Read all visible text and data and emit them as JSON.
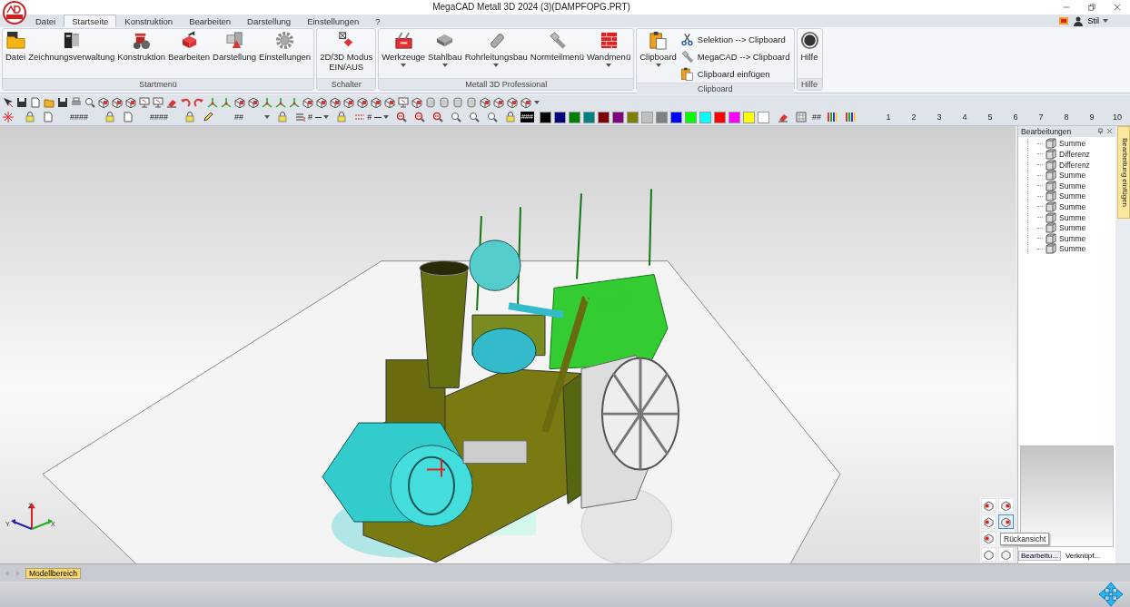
{
  "window": {
    "title": "MegaCAD Metall 3D 2024 (3)(DAMPFOPG.PRT)"
  },
  "tabs": [
    {
      "label": "Datei",
      "selected": false
    },
    {
      "label": "Startseite",
      "selected": true
    },
    {
      "label": "Konstruktion",
      "selected": false
    },
    {
      "label": "Bearbeiten",
      "selected": false
    },
    {
      "label": "Darstellung",
      "selected": false
    },
    {
      "label": "Einstellungen",
      "selected": false
    },
    {
      "label": "?",
      "selected": false
    }
  ],
  "style_menu": {
    "label": "Stil"
  },
  "ribbon_groups": [
    {
      "title": "Startmenü",
      "buttons": [
        {
          "kind": "large",
          "label": "Datei",
          "dropdown": false
        },
        {
          "kind": "large",
          "label": "Zeichnungsverwaltung",
          "dropdown": false
        },
        {
          "kind": "large",
          "label": "Konstruktion",
          "dropdown": false
        },
        {
          "kind": "large",
          "label": "Bearbeiten",
          "dropdown": false
        },
        {
          "kind": "large",
          "label": "Darstellung",
          "dropdown": false
        },
        {
          "kind": "large",
          "label": "Einstellungen",
          "dropdown": false
        }
      ]
    },
    {
      "title": "Schalter",
      "buttons": [
        {
          "kind": "large",
          "label": "2D/3D Modus\nEIN/AUS",
          "dropdown": false
        }
      ]
    },
    {
      "title": "Metall 3D Professional",
      "buttons": [
        {
          "kind": "large",
          "label": "Werkzeuge",
          "dropdown": true
        },
        {
          "kind": "large",
          "label": "Stahlbau",
          "dropdown": true
        },
        {
          "kind": "large",
          "label": "Rohrleitungsbau",
          "dropdown": true
        },
        {
          "kind": "large",
          "label": "Normteilmenü",
          "dropdown": false
        },
        {
          "kind": "large",
          "label": "Wandmenü",
          "dropdown": true
        }
      ]
    },
    {
      "title": "Clipboard",
      "buttons": [
        {
          "kind": "large",
          "label": "Clipboard",
          "dropdown": true
        },
        {
          "kind": "small",
          "label": "Selektion --> Clipboard",
          "dropdown": false
        },
        {
          "kind": "small",
          "label": "MegaCAD --> Clipboard",
          "dropdown": false
        },
        {
          "kind": "small",
          "label": "Clipboard einfügen",
          "dropdown": false
        }
      ]
    },
    {
      "title": "Hilfe",
      "buttons": [
        {
          "kind": "large",
          "label": "Hilfe",
          "dropdown": false
        }
      ]
    }
  ],
  "properties_bar": {
    "fields": [
      "####",
      "####",
      "##"
    ],
    "line_fields": [
      "#",
      "#"
    ],
    "color_field": "###",
    "grid_label": "##"
  },
  "palette": [
    {
      "color": "#000000"
    },
    {
      "color": "#000080"
    },
    {
      "color": "#008000"
    },
    {
      "color": "#008080"
    },
    {
      "color": "#800000"
    },
    {
      "color": "#800080"
    },
    {
      "color": "#808000"
    },
    {
      "color": "#c0c0c0"
    },
    {
      "color": "#808080"
    },
    {
      "color": "#0000ff"
    },
    {
      "color": "#00ff00"
    },
    {
      "color": "#00ffff"
    },
    {
      "color": "#ff0000"
    },
    {
      "color": "#ff00ff"
    },
    {
      "color": "#ffff00"
    },
    {
      "color": "#ffffff"
    }
  ],
  "layers": [
    "1",
    "2",
    "3",
    "4",
    "5",
    "6",
    "7",
    "8",
    "9",
    "10"
  ],
  "viewport": {
    "axes": [
      "Z",
      "Y",
      "X"
    ],
    "view_buttons": [
      {
        "selected": false
      },
      {
        "selected": false
      },
      {
        "selected": false
      },
      {
        "selected": true
      },
      {
        "selected": false
      },
      {
        "selected": false
      },
      {
        "selected": false
      }
    ],
    "tooltip": "Rückansicht"
  },
  "panel": {
    "title": "Bearbeitungen",
    "items": [
      "Summe",
      "Differenz",
      "Differenz",
      "Summe",
      "Summe",
      "Summe",
      "Summe",
      "Summe",
      "Summe",
      "Summe",
      "Summe"
    ],
    "tabs": [
      {
        "label": "Bearbeitu...",
        "selected": true
      },
      {
        "label": "Verknüpf...",
        "selected": false
      }
    ],
    "side_tab": "Bearbeitung einfügen"
  },
  "sheet_tabs": [
    {
      "label": "Modellbereich",
      "selected": true
    }
  ]
}
